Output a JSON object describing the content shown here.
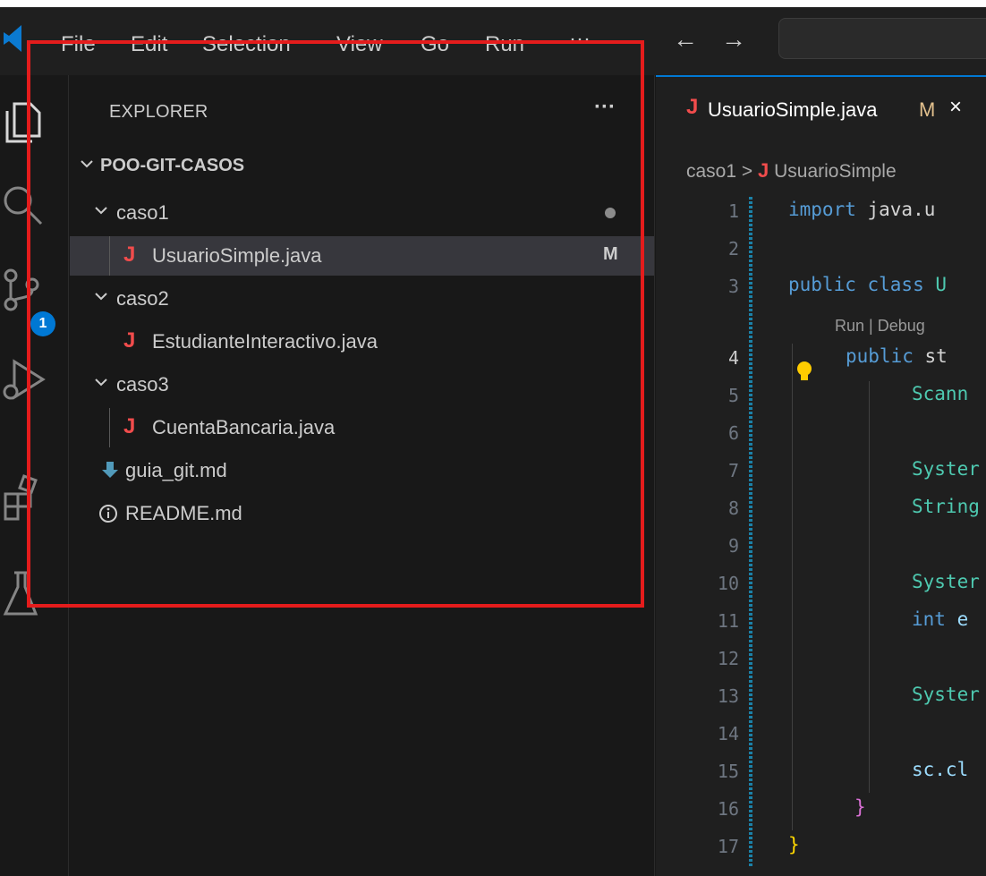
{
  "menu": {
    "items": [
      "File",
      "Edit",
      "Selection",
      "View",
      "Go",
      "Run",
      "···"
    ]
  },
  "nav": {
    "back": "←",
    "forward": "→"
  },
  "activity_bar": {
    "icons": [
      "explorer-icon",
      "search-icon",
      "source-control-icon",
      "run-debug-icon",
      "extensions-icon",
      "testing-icon"
    ],
    "source_control_badge": "1"
  },
  "explorer": {
    "title": "EXPLORER",
    "more": "···",
    "root": "POO-GIT-CASOS",
    "tree": [
      {
        "label": "caso1",
        "type": "folder",
        "status_dot": true
      },
      {
        "label": "UsuarioSimple.java",
        "type": "java",
        "status": "M",
        "selected": true
      },
      {
        "label": "caso2",
        "type": "folder"
      },
      {
        "label": "EstudianteInteractivo.java",
        "type": "java"
      },
      {
        "label": "caso3",
        "type": "folder"
      },
      {
        "label": "CuentaBancaria.java",
        "type": "java"
      },
      {
        "label": "guia_git.md",
        "type": "markdown"
      },
      {
        "label": "README.md",
        "type": "info"
      }
    ]
  },
  "editor": {
    "tab": {
      "icon": "J",
      "title": "UsuarioSimple.java",
      "status": "M",
      "close": "×"
    },
    "breadcrumb": {
      "folder": "caso1",
      "sep": ">",
      "icon": "J",
      "file": "UsuarioSimple"
    },
    "codelens": "Run | Debug",
    "line_numbers": [
      "1",
      "2",
      "3",
      "4",
      "5",
      "6",
      "7",
      "8",
      "9",
      "10",
      "11",
      "12",
      "13",
      "14",
      "15",
      "16",
      "17"
    ],
    "code": {
      "l1_kw": "import",
      "l1_rest": " java.u",
      "l3_kw1": "public",
      "l3_kw2": " class",
      "l3_rest": " U",
      "l4_kw": "public",
      "l4_rest": " st",
      "l5": "Scann",
      "l7": "Syster",
      "l8": "String",
      "l10": "Syster",
      "l11_kw": "int",
      "l11_rest": " e",
      "l13": "Syster",
      "l15": "sc.cl",
      "l16": "}",
      "l17": "}"
    }
  },
  "colors": {
    "annotation": "#e41c1c",
    "java_icon": "#f14c4c",
    "accent": "#0078d4"
  }
}
